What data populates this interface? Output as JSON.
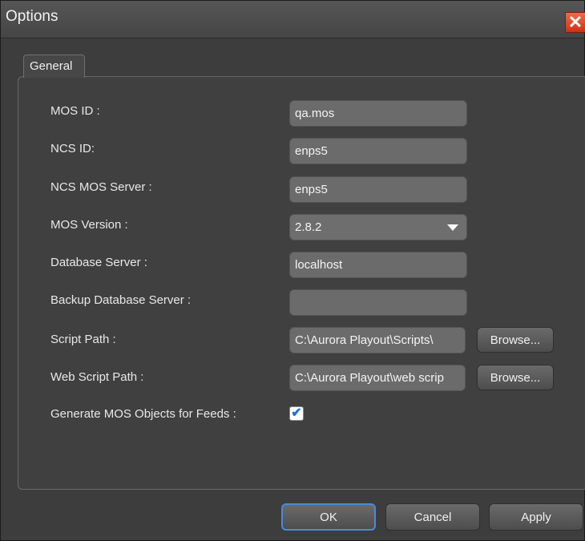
{
  "window": {
    "title": "Options"
  },
  "tabs": [
    {
      "label": "General"
    }
  ],
  "form": {
    "mos_id": {
      "label": "MOS ID :",
      "value": "qa.mos"
    },
    "ncs_id": {
      "label": "NCS ID:",
      "value": "enps5"
    },
    "ncs_mos_server": {
      "label": "NCS MOS Server :",
      "value": "enps5"
    },
    "mos_version": {
      "label": "MOS Version :",
      "value": "2.8.2"
    },
    "database_server": {
      "label": "Database Server :",
      "value": "localhost"
    },
    "backup_database_server": {
      "label": "Backup Database Server :",
      "value": ""
    },
    "script_path": {
      "label": "Script Path :",
      "value": "C:\\Aurora Playout\\Scripts\\"
    },
    "web_script_path": {
      "label": "Web Script Path :",
      "value": "C:\\Aurora Playout\\web scrip"
    },
    "generate_mos": {
      "label": "Generate MOS Objects for Feeds :",
      "checked": true
    },
    "browse_label": "Browse..."
  },
  "footer": {
    "ok": "OK",
    "cancel": "Cancel",
    "apply": "Apply"
  },
  "icons": {
    "close": "close-icon",
    "dropdown": "chevron-down-icon",
    "check": "checkmark-icon"
  }
}
